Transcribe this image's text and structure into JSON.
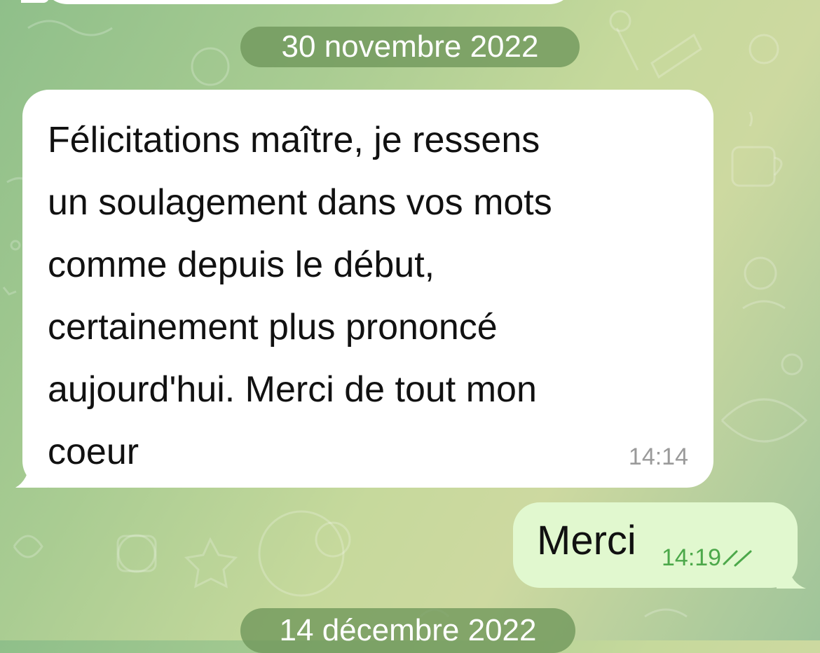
{
  "chat": {
    "date_separator_1": "30 novembre 2022",
    "date_separator_2": "14 décembre 2022",
    "incoming_message": {
      "text": "Félicitations maître, je ressens\nun soulagement dans vos mots\ncomme depuis le début,\ncertainement plus prononcé\naujourd'hui. Merci de tout mon\ncoeur",
      "time": "14:14"
    },
    "outgoing_message": {
      "text": "Merci",
      "time": "14:19",
      "status_icon": "double-check-icon"
    }
  },
  "colors": {
    "incoming_bubble": "#ffffff",
    "outgoing_bubble": "#e1f8cf",
    "outgoing_meta": "#4ca84a",
    "date_pill": "#6e965a"
  }
}
